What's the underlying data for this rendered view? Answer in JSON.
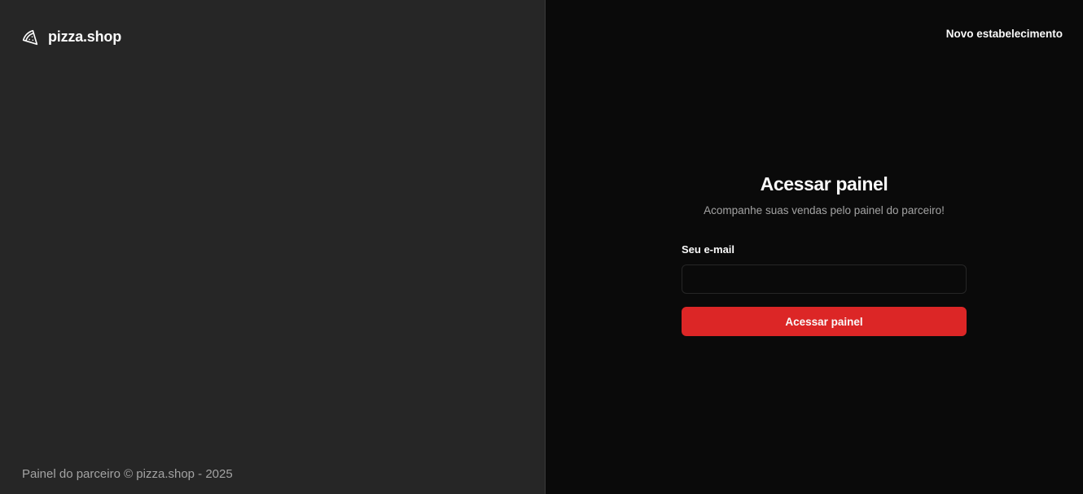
{
  "brand": {
    "name": "pizza.shop",
    "icon": "pizza-slice-icon"
  },
  "footer": {
    "text": "Painel do parceiro © pizza.shop - 2025"
  },
  "header": {
    "new_store_link": "Novo estabelecimento"
  },
  "login_form": {
    "title": "Acessar painel",
    "subtitle": "Acompanhe suas vendas pelo painel do parceiro!",
    "email_label": "Seu e-mail",
    "email_value": "",
    "email_placeholder": "",
    "submit_label": "Acessar painel"
  },
  "colors": {
    "left_panel_bg": "#262626",
    "right_panel_bg": "#0a0a0a",
    "accent": "#dc2626",
    "text_primary": "#fafafa",
    "text_muted": "#a3a3a3"
  }
}
